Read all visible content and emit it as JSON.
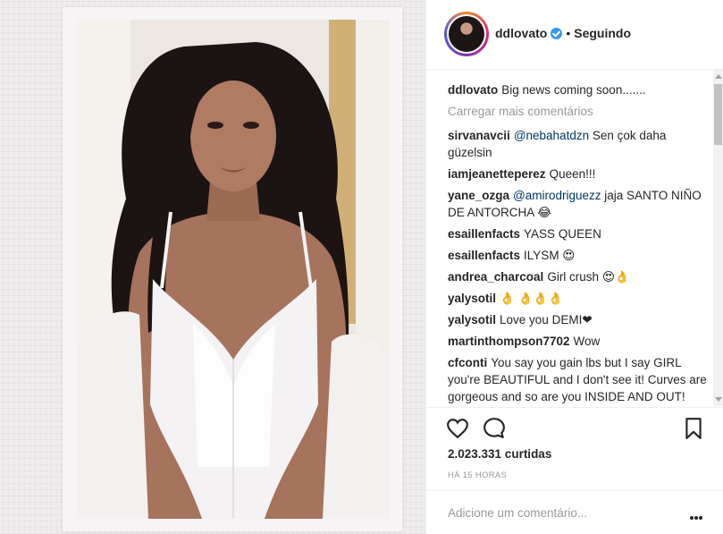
{
  "post": {
    "username": "ddlovato",
    "separator": "•",
    "follow_status": "Seguindo",
    "caption_user": "ddlovato",
    "caption_text": "Big news coming soon.......",
    "load_more": "Carregar mais comentários",
    "likes": "2.023.331 curtidas",
    "time_ago": "HÁ 15 HORAS",
    "add_comment_placeholder": "Adicione um comentário..."
  },
  "comments": [
    {
      "user": "sirvanavcii",
      "mention": "@nebahatdzn",
      "text": " Sen çok daha güzelsin"
    },
    {
      "user": "iamjeanetteperez",
      "mention": "",
      "text": "Queen!!!"
    },
    {
      "user": "yane_ozga",
      "mention": "@amirodriguezz",
      "text": " jaja SANTO NIÑO DE ANTORCHA 😂"
    },
    {
      "user": "esaillenfacts",
      "mention": "",
      "text": "YASS QUEEN"
    },
    {
      "user": "esaillenfacts",
      "mention": "",
      "text": "ILYSM 😍"
    },
    {
      "user": "andrea_charcoal",
      "mention": "",
      "text": "Girl crush 😍👌"
    },
    {
      "user": "yalysotil",
      "mention": "",
      "text": "👌 👌👌👌"
    },
    {
      "user": "yalysotil",
      "mention": "",
      "text": "Love you DEMI❤"
    },
    {
      "user": "martinthompson7702",
      "mention": "",
      "text": "Wow"
    },
    {
      "user": "cfconti",
      "mention": "",
      "text": "You say you gain lbs but I say GIRL you're BEAUTIFUL and I don't see it! Curves are gorgeous and so are you INSIDE AND OUT!"
    }
  ],
  "icons": {
    "like": "heart-icon",
    "comment": "comment-bubble-icon",
    "save": "bookmark-icon",
    "verified": "verified-badge-icon",
    "more": "more-options-icon"
  },
  "colors": {
    "verified": "#3897f0",
    "mention": "#003569",
    "muted": "#999999"
  }
}
